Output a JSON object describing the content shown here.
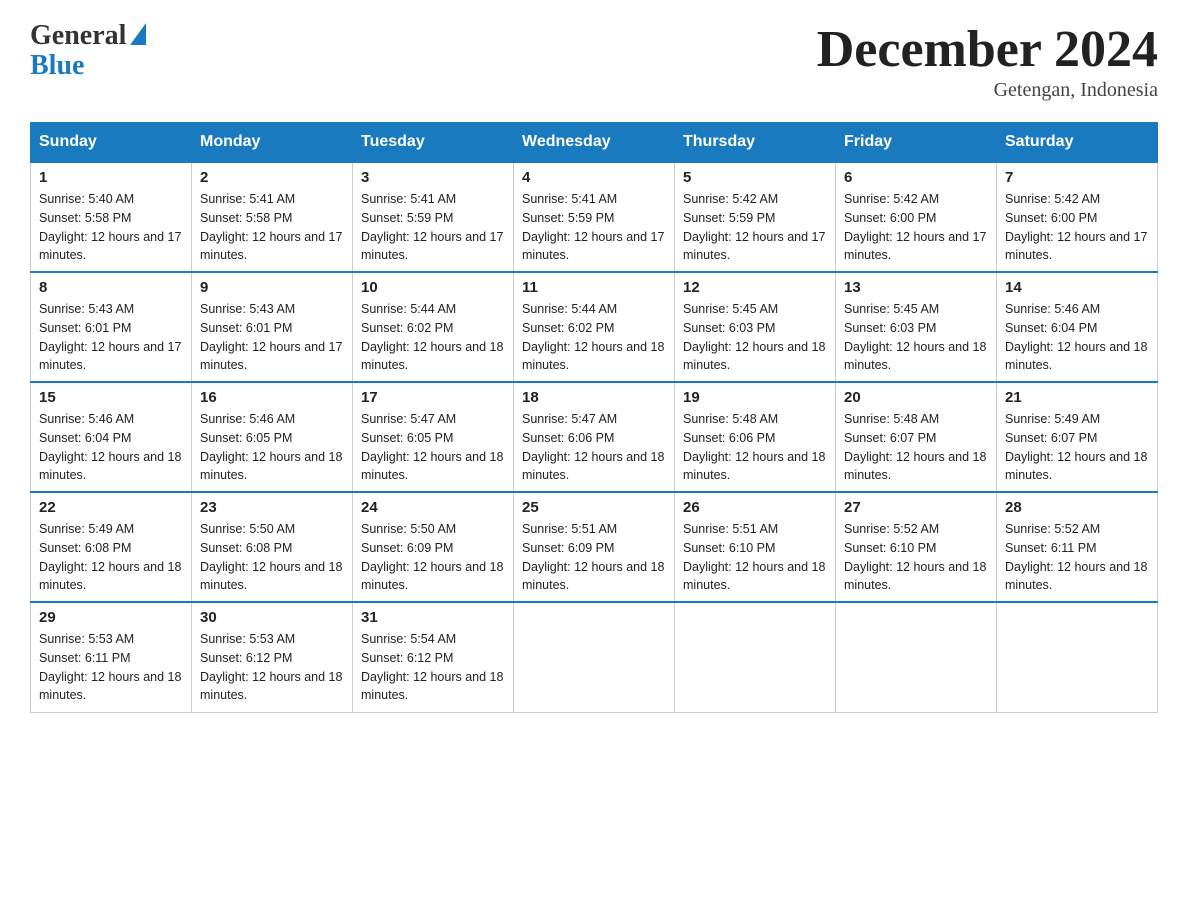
{
  "header": {
    "logo_general": "General",
    "logo_blue": "Blue",
    "title": "December 2024",
    "location": "Getengan, Indonesia"
  },
  "days_of_week": [
    "Sunday",
    "Monday",
    "Tuesday",
    "Wednesday",
    "Thursday",
    "Friday",
    "Saturday"
  ],
  "weeks": [
    [
      {
        "day": "1",
        "sunrise": "5:40 AM",
        "sunset": "5:58 PM",
        "daylight": "12 hours and 17 minutes."
      },
      {
        "day": "2",
        "sunrise": "5:41 AM",
        "sunset": "5:58 PM",
        "daylight": "12 hours and 17 minutes."
      },
      {
        "day": "3",
        "sunrise": "5:41 AM",
        "sunset": "5:59 PM",
        "daylight": "12 hours and 17 minutes."
      },
      {
        "day": "4",
        "sunrise": "5:41 AM",
        "sunset": "5:59 PM",
        "daylight": "12 hours and 17 minutes."
      },
      {
        "day": "5",
        "sunrise": "5:42 AM",
        "sunset": "5:59 PM",
        "daylight": "12 hours and 17 minutes."
      },
      {
        "day": "6",
        "sunrise": "5:42 AM",
        "sunset": "6:00 PM",
        "daylight": "12 hours and 17 minutes."
      },
      {
        "day": "7",
        "sunrise": "5:42 AM",
        "sunset": "6:00 PM",
        "daylight": "12 hours and 17 minutes."
      }
    ],
    [
      {
        "day": "8",
        "sunrise": "5:43 AM",
        "sunset": "6:01 PM",
        "daylight": "12 hours and 17 minutes."
      },
      {
        "day": "9",
        "sunrise": "5:43 AM",
        "sunset": "6:01 PM",
        "daylight": "12 hours and 17 minutes."
      },
      {
        "day": "10",
        "sunrise": "5:44 AM",
        "sunset": "6:02 PM",
        "daylight": "12 hours and 18 minutes."
      },
      {
        "day": "11",
        "sunrise": "5:44 AM",
        "sunset": "6:02 PM",
        "daylight": "12 hours and 18 minutes."
      },
      {
        "day": "12",
        "sunrise": "5:45 AM",
        "sunset": "6:03 PM",
        "daylight": "12 hours and 18 minutes."
      },
      {
        "day": "13",
        "sunrise": "5:45 AM",
        "sunset": "6:03 PM",
        "daylight": "12 hours and 18 minutes."
      },
      {
        "day": "14",
        "sunrise": "5:46 AM",
        "sunset": "6:04 PM",
        "daylight": "12 hours and 18 minutes."
      }
    ],
    [
      {
        "day": "15",
        "sunrise": "5:46 AM",
        "sunset": "6:04 PM",
        "daylight": "12 hours and 18 minutes."
      },
      {
        "day": "16",
        "sunrise": "5:46 AM",
        "sunset": "6:05 PM",
        "daylight": "12 hours and 18 minutes."
      },
      {
        "day": "17",
        "sunrise": "5:47 AM",
        "sunset": "6:05 PM",
        "daylight": "12 hours and 18 minutes."
      },
      {
        "day": "18",
        "sunrise": "5:47 AM",
        "sunset": "6:06 PM",
        "daylight": "12 hours and 18 minutes."
      },
      {
        "day": "19",
        "sunrise": "5:48 AM",
        "sunset": "6:06 PM",
        "daylight": "12 hours and 18 minutes."
      },
      {
        "day": "20",
        "sunrise": "5:48 AM",
        "sunset": "6:07 PM",
        "daylight": "12 hours and 18 minutes."
      },
      {
        "day": "21",
        "sunrise": "5:49 AM",
        "sunset": "6:07 PM",
        "daylight": "12 hours and 18 minutes."
      }
    ],
    [
      {
        "day": "22",
        "sunrise": "5:49 AM",
        "sunset": "6:08 PM",
        "daylight": "12 hours and 18 minutes."
      },
      {
        "day": "23",
        "sunrise": "5:50 AM",
        "sunset": "6:08 PM",
        "daylight": "12 hours and 18 minutes."
      },
      {
        "day": "24",
        "sunrise": "5:50 AM",
        "sunset": "6:09 PM",
        "daylight": "12 hours and 18 minutes."
      },
      {
        "day": "25",
        "sunrise": "5:51 AM",
        "sunset": "6:09 PM",
        "daylight": "12 hours and 18 minutes."
      },
      {
        "day": "26",
        "sunrise": "5:51 AM",
        "sunset": "6:10 PM",
        "daylight": "12 hours and 18 minutes."
      },
      {
        "day": "27",
        "sunrise": "5:52 AM",
        "sunset": "6:10 PM",
        "daylight": "12 hours and 18 minutes."
      },
      {
        "day": "28",
        "sunrise": "5:52 AM",
        "sunset": "6:11 PM",
        "daylight": "12 hours and 18 minutes."
      }
    ],
    [
      {
        "day": "29",
        "sunrise": "5:53 AM",
        "sunset": "6:11 PM",
        "daylight": "12 hours and 18 minutes."
      },
      {
        "day": "30",
        "sunrise": "5:53 AM",
        "sunset": "6:12 PM",
        "daylight": "12 hours and 18 minutes."
      },
      {
        "day": "31",
        "sunrise": "5:54 AM",
        "sunset": "6:12 PM",
        "daylight": "12 hours and 18 minutes."
      },
      null,
      null,
      null,
      null
    ]
  ]
}
